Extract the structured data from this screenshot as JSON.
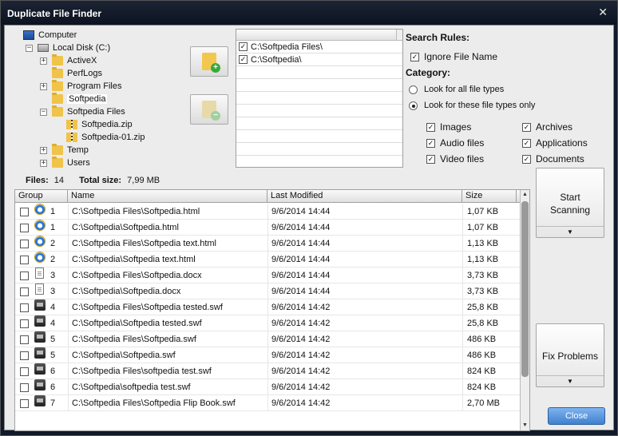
{
  "window": {
    "title": "Duplicate File Finder",
    "close_glyph": "✕"
  },
  "tree": [
    {
      "label": "Computer",
      "icon": "computer-icon",
      "indent": 0,
      "toggle": ""
    },
    {
      "label": "Local Disk (C:)",
      "icon": "disk-icon",
      "indent": 1,
      "toggle": "−"
    },
    {
      "label": "ActiveX",
      "icon": "folder-icon",
      "indent": 2,
      "toggle": "+"
    },
    {
      "label": "PerfLogs",
      "icon": "folder-icon",
      "indent": 2,
      "toggle": ""
    },
    {
      "label": "Program Files",
      "icon": "folder-icon",
      "indent": 2,
      "toggle": "+"
    },
    {
      "label": "Softpedia",
      "icon": "folder-icon",
      "indent": 2,
      "toggle": "",
      "selected": true
    },
    {
      "label": "Softpedia Files",
      "icon": "folder-icon",
      "indent": 2,
      "toggle": "−"
    },
    {
      "label": "Softpedia.zip",
      "icon": "zip-folder-icon",
      "indent": 3,
      "toggle": ""
    },
    {
      "label": "Softpedia-01.zip",
      "icon": "zip-folder-icon",
      "indent": 3,
      "toggle": ""
    },
    {
      "label": "Temp",
      "icon": "folder-icon",
      "indent": 2,
      "toggle": "+"
    },
    {
      "label": "Users",
      "icon": "folder-icon",
      "indent": 2,
      "toggle": "+"
    }
  ],
  "folder_list": {
    "paths": [
      {
        "path": "C:\\Softpedia Files\\",
        "checked": true
      },
      {
        "path": "C:\\Softpedia\\",
        "checked": true
      }
    ]
  },
  "search_rules": {
    "title": "Search Rules:",
    "ignore_file_name": {
      "label": "Ignore File Name",
      "checked": true
    },
    "category_title": "Category:",
    "radio_all": {
      "label": "Look for all file types",
      "selected": false
    },
    "radio_these": {
      "label": "Look for these file types only",
      "selected": true
    },
    "types": [
      {
        "label": "Images",
        "checked": true
      },
      {
        "label": "Archives",
        "checked": true
      },
      {
        "label": "Audio files",
        "checked": true
      },
      {
        "label": "Applications",
        "checked": true
      },
      {
        "label": "Video files",
        "checked": true
      },
      {
        "label": "Documents",
        "checked": true
      }
    ]
  },
  "stats": {
    "files_label": "Files:",
    "files_value": "14",
    "size_label": "Total size:",
    "size_value": "7,99 MB"
  },
  "table": {
    "columns": [
      "Group",
      "Name",
      "Last Modified",
      "Size"
    ],
    "rows": [
      {
        "group": "1",
        "icon": "ie-icon",
        "name": "C:\\Softpedia Files\\Softpedia.html",
        "modified": "9/6/2014 14:44",
        "size": "1,07 KB"
      },
      {
        "group": "1",
        "icon": "ie-icon",
        "name": "C:\\Softpedia\\Softpedia.html",
        "modified": "9/6/2014 14:44",
        "size": "1,07 KB"
      },
      {
        "group": "2",
        "icon": "ie-icon",
        "name": "C:\\Softpedia Files\\Softpedia text.html",
        "modified": "9/6/2014 14:44",
        "size": "1,13 KB"
      },
      {
        "group": "2",
        "icon": "ie-icon",
        "name": "C:\\Softpedia\\Softpedia text.html",
        "modified": "9/6/2014 14:44",
        "size": "1,13 KB"
      },
      {
        "group": "3",
        "icon": "doc-icon",
        "name": "C:\\Softpedia Files\\Softpedia.docx",
        "modified": "9/6/2014 14:44",
        "size": "3,73 KB"
      },
      {
        "group": "3",
        "icon": "doc-icon",
        "name": "C:\\Softpedia\\Softpedia.docx",
        "modified": "9/6/2014 14:44",
        "size": "3,73 KB"
      },
      {
        "group": "4",
        "icon": "swf-icon",
        "name": "C:\\Softpedia Files\\Softpedia tested.swf",
        "modified": "9/6/2014 14:42",
        "size": "25,8 KB"
      },
      {
        "group": "4",
        "icon": "swf-icon",
        "name": "C:\\Softpedia\\Softpedia tested.swf",
        "modified": "9/6/2014 14:42",
        "size": "25,8 KB"
      },
      {
        "group": "5",
        "icon": "swf-icon",
        "name": "C:\\Softpedia Files\\Softpedia.swf",
        "modified": "9/6/2014 14:42",
        "size": "486 KB"
      },
      {
        "group": "5",
        "icon": "swf-icon",
        "name": "C:\\Softpedia\\Softpedia.swf",
        "modified": "9/6/2014 14:42",
        "size": "486 KB"
      },
      {
        "group": "6",
        "icon": "swf-icon",
        "name": "C:\\Softpedia Files\\softpedia test.swf",
        "modified": "9/6/2014 14:42",
        "size": "824 KB"
      },
      {
        "group": "6",
        "icon": "swf-icon",
        "name": "C:\\Softpedia\\softpedia test.swf",
        "modified": "9/6/2014 14:42",
        "size": "824 KB"
      },
      {
        "group": "7",
        "icon": "swf-icon",
        "name": "C:\\Softpedia Files\\Softpedia Flip Book.swf",
        "modified": "9/6/2014 14:42",
        "size": "2,70 MB"
      }
    ]
  },
  "buttons": {
    "start_line1": "Start",
    "start_line2": "Scanning",
    "fix": "Fix Problems",
    "close": "Close",
    "dropdown_glyph": "▼"
  }
}
